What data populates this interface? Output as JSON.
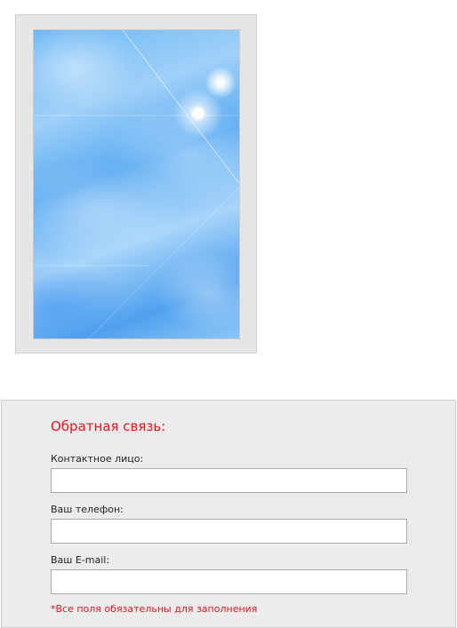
{
  "image_frame": {
    "picture": "sky-with-clouds-and-sun"
  },
  "feedback_form": {
    "title": "Обратная связь:",
    "fields": [
      {
        "label": "Контактное лицо:",
        "value": ""
      },
      {
        "label": "Ваш телефон:",
        "value": ""
      },
      {
        "label": "Ваш E-mail:",
        "value": ""
      }
    ],
    "required_note": "*Все поля обязательны для заполнения"
  },
  "colors": {
    "accent_red": "#e8141e",
    "panel_bg": "#ececec",
    "frame_bg": "#e6e6e6"
  }
}
